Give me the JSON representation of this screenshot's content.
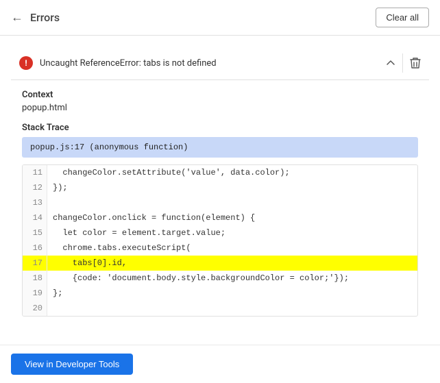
{
  "header": {
    "back_label": "←",
    "title": "Errors",
    "clear_all_label": "Clear all"
  },
  "error": {
    "message": "Uncaught ReferenceError: tabs is not defined",
    "context_label": "Context",
    "context_value": "popup.html",
    "stack_trace_label": "Stack Trace",
    "stack_trace_value": "popup.js:17 (anonymous function)"
  },
  "code": {
    "lines": [
      {
        "number": "11",
        "content": "  changeColor.setAttribute('value', data.color);",
        "highlighted": false
      },
      {
        "number": "12",
        "content": "});",
        "highlighted": false
      },
      {
        "number": "13",
        "content": "",
        "highlighted": false
      },
      {
        "number": "14",
        "content": "changeColor.onclick = function(element) {",
        "highlighted": false
      },
      {
        "number": "15",
        "content": "  let color = element.target.value;",
        "highlighted": false
      },
      {
        "number": "16",
        "content": "  chrome.tabs.executeScript(",
        "highlighted": false
      },
      {
        "number": "17",
        "content": "    tabs[0].id,",
        "highlighted": true
      },
      {
        "number": "18",
        "content": "    {code: 'document.body.style.backgroundColor = color;'});",
        "highlighted": false
      },
      {
        "number": "19",
        "content": "};",
        "highlighted": false
      },
      {
        "number": "20",
        "content": "",
        "highlighted": false
      }
    ]
  },
  "footer": {
    "view_devtools_label": "View in Developer Tools"
  }
}
